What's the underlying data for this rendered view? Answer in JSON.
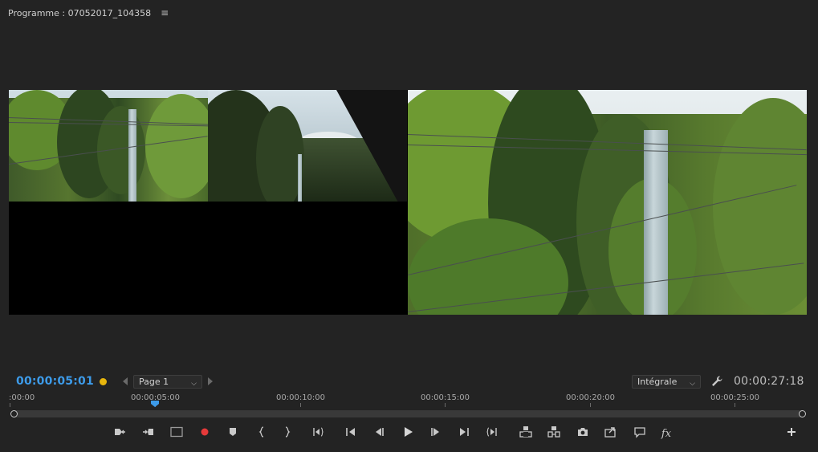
{
  "panel": {
    "title": "Programme : 07052017_104358",
    "menu_icon": "hamburger-menu-icon"
  },
  "viewer": {
    "selected_camera_outline": "#f2e43a"
  },
  "controls": {
    "current_timecode": "00:00:05:01",
    "current_timecode_color": "#3d9be9",
    "marker_color": "#e8b60d",
    "page_select": {
      "value": "Page 1"
    },
    "quality_select": {
      "value": "Intégrale"
    },
    "total_timecode": "00:00:27:18"
  },
  "ruler": {
    "labels": [
      ":00:00",
      "00:00:05:00",
      "00:00:10:00",
      "00:00:15:00",
      "00:00:20:00",
      "00:00:25:00"
    ]
  },
  "transport": {
    "buttons": [
      {
        "name": "add-marker-in-button",
        "icon": "mark-in-left-icon"
      },
      {
        "name": "add-marker-out-button",
        "icon": "mark-out-right-icon"
      },
      {
        "name": "safe-margins-button",
        "icon": "rectangle-icon"
      },
      {
        "name": "record-button",
        "icon": "record-dot-icon"
      },
      {
        "name": "add-marker-button",
        "icon": "marker-icon"
      },
      {
        "name": "mark-in-button",
        "icon": "open-brace-icon"
      },
      {
        "name": "mark-out-button",
        "icon": "close-brace-icon"
      },
      {
        "name": "go-to-in-button",
        "icon": "go-to-in-icon"
      },
      {
        "name": "step-back-button",
        "icon": "step-back-icon"
      },
      {
        "name": "step-back-frame-button",
        "icon": "frame-back-icon"
      },
      {
        "name": "play-button",
        "icon": "play-icon"
      },
      {
        "name": "step-forward-frame-button",
        "icon": "frame-forward-icon"
      },
      {
        "name": "step-forward-button",
        "icon": "step-forward-icon"
      },
      {
        "name": "go-to-out-button",
        "icon": "go-to-out-icon"
      },
      {
        "name": "lift-button",
        "icon": "lift-icon"
      },
      {
        "name": "extract-button",
        "icon": "extract-icon"
      },
      {
        "name": "export-frame-button",
        "icon": "camera-icon"
      },
      {
        "name": "insert-button",
        "icon": "insert-icon"
      },
      {
        "name": "comment-button",
        "icon": "speech-bubble-icon"
      },
      {
        "name": "effects-button",
        "icon": "fx-icon"
      },
      {
        "name": "button-editor-button",
        "icon": "plus-icon"
      }
    ]
  }
}
